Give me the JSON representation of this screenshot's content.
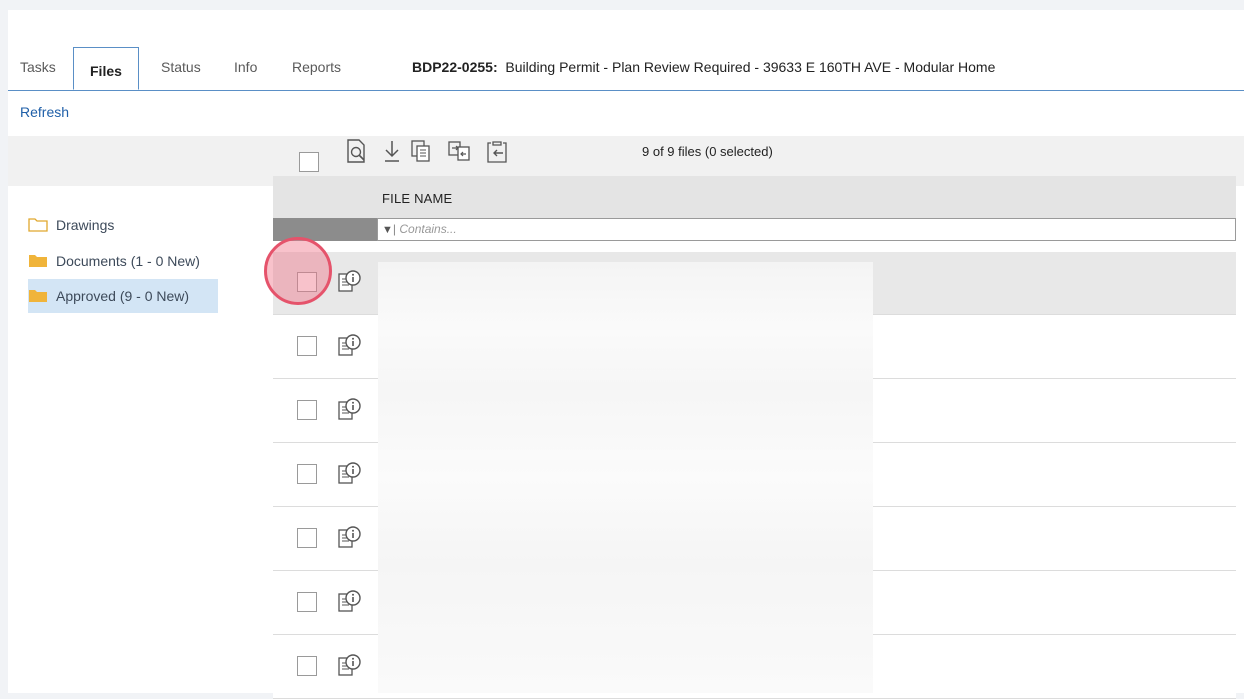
{
  "tabs": [
    {
      "label": "Tasks",
      "active": false
    },
    {
      "label": "Files",
      "active": true
    },
    {
      "label": "Status",
      "active": false
    },
    {
      "label": "Info",
      "active": false
    },
    {
      "label": "Reports",
      "active": false
    }
  ],
  "permit": {
    "id": "BDP22-0255:",
    "description": "Building Permit - Plan Review Required - 39633 E 160TH AVE - Modular Home"
  },
  "refresh_label": "Refresh",
  "toolbar": {
    "icons": [
      "preview-icon",
      "download-icon",
      "copy-icon",
      "move-icon",
      "paste-icon"
    ],
    "count_text": "9 of 9 files (0 selected)"
  },
  "folders": [
    {
      "label": "Drawings",
      "icon": "folder-outline-icon",
      "selected": false
    },
    {
      "label": "Documents (1 - 0 New)",
      "icon": "folder-filled-icon",
      "selected": false
    },
    {
      "label": "Approved (9 - 0 New)",
      "icon": "folder-filled-icon",
      "selected": true
    }
  ],
  "grid": {
    "column_header": "FILE NAME",
    "filter_placeholder": "Contains...",
    "visible_rows": 7
  },
  "colors": {
    "accent": "#5a8fc6",
    "link": "#1f5fa8",
    "folder": "#f0b43a",
    "selected": "#d3e5f5",
    "click_marker": "#e5536b"
  }
}
